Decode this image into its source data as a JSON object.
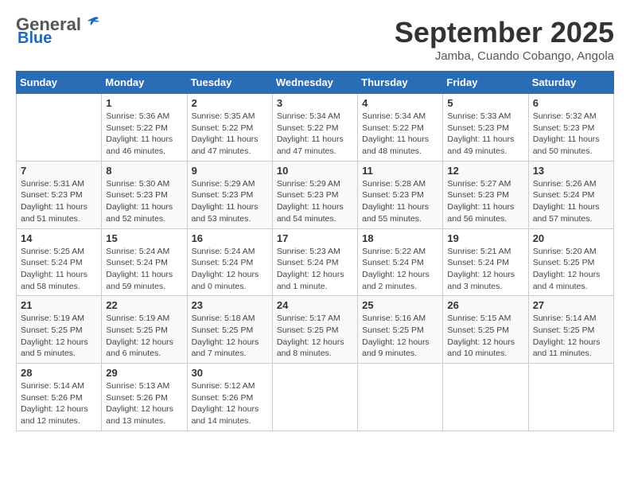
{
  "header": {
    "logo_general": "General",
    "logo_blue": "Blue",
    "month_title": "September 2025",
    "location": "Jamba, Cuando Cobango, Angola"
  },
  "weekdays": [
    "Sunday",
    "Monday",
    "Tuesday",
    "Wednesday",
    "Thursday",
    "Friday",
    "Saturday"
  ],
  "weeks": [
    [
      {
        "day": "",
        "info": ""
      },
      {
        "day": "1",
        "info": "Sunrise: 5:36 AM\nSunset: 5:22 PM\nDaylight: 11 hours\nand 46 minutes."
      },
      {
        "day": "2",
        "info": "Sunrise: 5:35 AM\nSunset: 5:22 PM\nDaylight: 11 hours\nand 47 minutes."
      },
      {
        "day": "3",
        "info": "Sunrise: 5:34 AM\nSunset: 5:22 PM\nDaylight: 11 hours\nand 47 minutes."
      },
      {
        "day": "4",
        "info": "Sunrise: 5:34 AM\nSunset: 5:22 PM\nDaylight: 11 hours\nand 48 minutes."
      },
      {
        "day": "5",
        "info": "Sunrise: 5:33 AM\nSunset: 5:23 PM\nDaylight: 11 hours\nand 49 minutes."
      },
      {
        "day": "6",
        "info": "Sunrise: 5:32 AM\nSunset: 5:23 PM\nDaylight: 11 hours\nand 50 minutes."
      }
    ],
    [
      {
        "day": "7",
        "info": "Sunrise: 5:31 AM\nSunset: 5:23 PM\nDaylight: 11 hours\nand 51 minutes."
      },
      {
        "day": "8",
        "info": "Sunrise: 5:30 AM\nSunset: 5:23 PM\nDaylight: 11 hours\nand 52 minutes."
      },
      {
        "day": "9",
        "info": "Sunrise: 5:29 AM\nSunset: 5:23 PM\nDaylight: 11 hours\nand 53 minutes."
      },
      {
        "day": "10",
        "info": "Sunrise: 5:29 AM\nSunset: 5:23 PM\nDaylight: 11 hours\nand 54 minutes."
      },
      {
        "day": "11",
        "info": "Sunrise: 5:28 AM\nSunset: 5:23 PM\nDaylight: 11 hours\nand 55 minutes."
      },
      {
        "day": "12",
        "info": "Sunrise: 5:27 AM\nSunset: 5:23 PM\nDaylight: 11 hours\nand 56 minutes."
      },
      {
        "day": "13",
        "info": "Sunrise: 5:26 AM\nSunset: 5:24 PM\nDaylight: 11 hours\nand 57 minutes."
      }
    ],
    [
      {
        "day": "14",
        "info": "Sunrise: 5:25 AM\nSunset: 5:24 PM\nDaylight: 11 hours\nand 58 minutes."
      },
      {
        "day": "15",
        "info": "Sunrise: 5:24 AM\nSunset: 5:24 PM\nDaylight: 11 hours\nand 59 minutes."
      },
      {
        "day": "16",
        "info": "Sunrise: 5:24 AM\nSunset: 5:24 PM\nDaylight: 12 hours\nand 0 minutes."
      },
      {
        "day": "17",
        "info": "Sunrise: 5:23 AM\nSunset: 5:24 PM\nDaylight: 12 hours\nand 1 minute."
      },
      {
        "day": "18",
        "info": "Sunrise: 5:22 AM\nSunset: 5:24 PM\nDaylight: 12 hours\nand 2 minutes."
      },
      {
        "day": "19",
        "info": "Sunrise: 5:21 AM\nSunset: 5:24 PM\nDaylight: 12 hours\nand 3 minutes."
      },
      {
        "day": "20",
        "info": "Sunrise: 5:20 AM\nSunset: 5:25 PM\nDaylight: 12 hours\nand 4 minutes."
      }
    ],
    [
      {
        "day": "21",
        "info": "Sunrise: 5:19 AM\nSunset: 5:25 PM\nDaylight: 12 hours\nand 5 minutes."
      },
      {
        "day": "22",
        "info": "Sunrise: 5:19 AM\nSunset: 5:25 PM\nDaylight: 12 hours\nand 6 minutes."
      },
      {
        "day": "23",
        "info": "Sunrise: 5:18 AM\nSunset: 5:25 PM\nDaylight: 12 hours\nand 7 minutes."
      },
      {
        "day": "24",
        "info": "Sunrise: 5:17 AM\nSunset: 5:25 PM\nDaylight: 12 hours\nand 8 minutes."
      },
      {
        "day": "25",
        "info": "Sunrise: 5:16 AM\nSunset: 5:25 PM\nDaylight: 12 hours\nand 9 minutes."
      },
      {
        "day": "26",
        "info": "Sunrise: 5:15 AM\nSunset: 5:25 PM\nDaylight: 12 hours\nand 10 minutes."
      },
      {
        "day": "27",
        "info": "Sunrise: 5:14 AM\nSunset: 5:25 PM\nDaylight: 12 hours\nand 11 minutes."
      }
    ],
    [
      {
        "day": "28",
        "info": "Sunrise: 5:14 AM\nSunset: 5:26 PM\nDaylight: 12 hours\nand 12 minutes."
      },
      {
        "day": "29",
        "info": "Sunrise: 5:13 AM\nSunset: 5:26 PM\nDaylight: 12 hours\nand 13 minutes."
      },
      {
        "day": "30",
        "info": "Sunrise: 5:12 AM\nSunset: 5:26 PM\nDaylight: 12 hours\nand 14 minutes."
      },
      {
        "day": "",
        "info": ""
      },
      {
        "day": "",
        "info": ""
      },
      {
        "day": "",
        "info": ""
      },
      {
        "day": "",
        "info": ""
      }
    ]
  ]
}
